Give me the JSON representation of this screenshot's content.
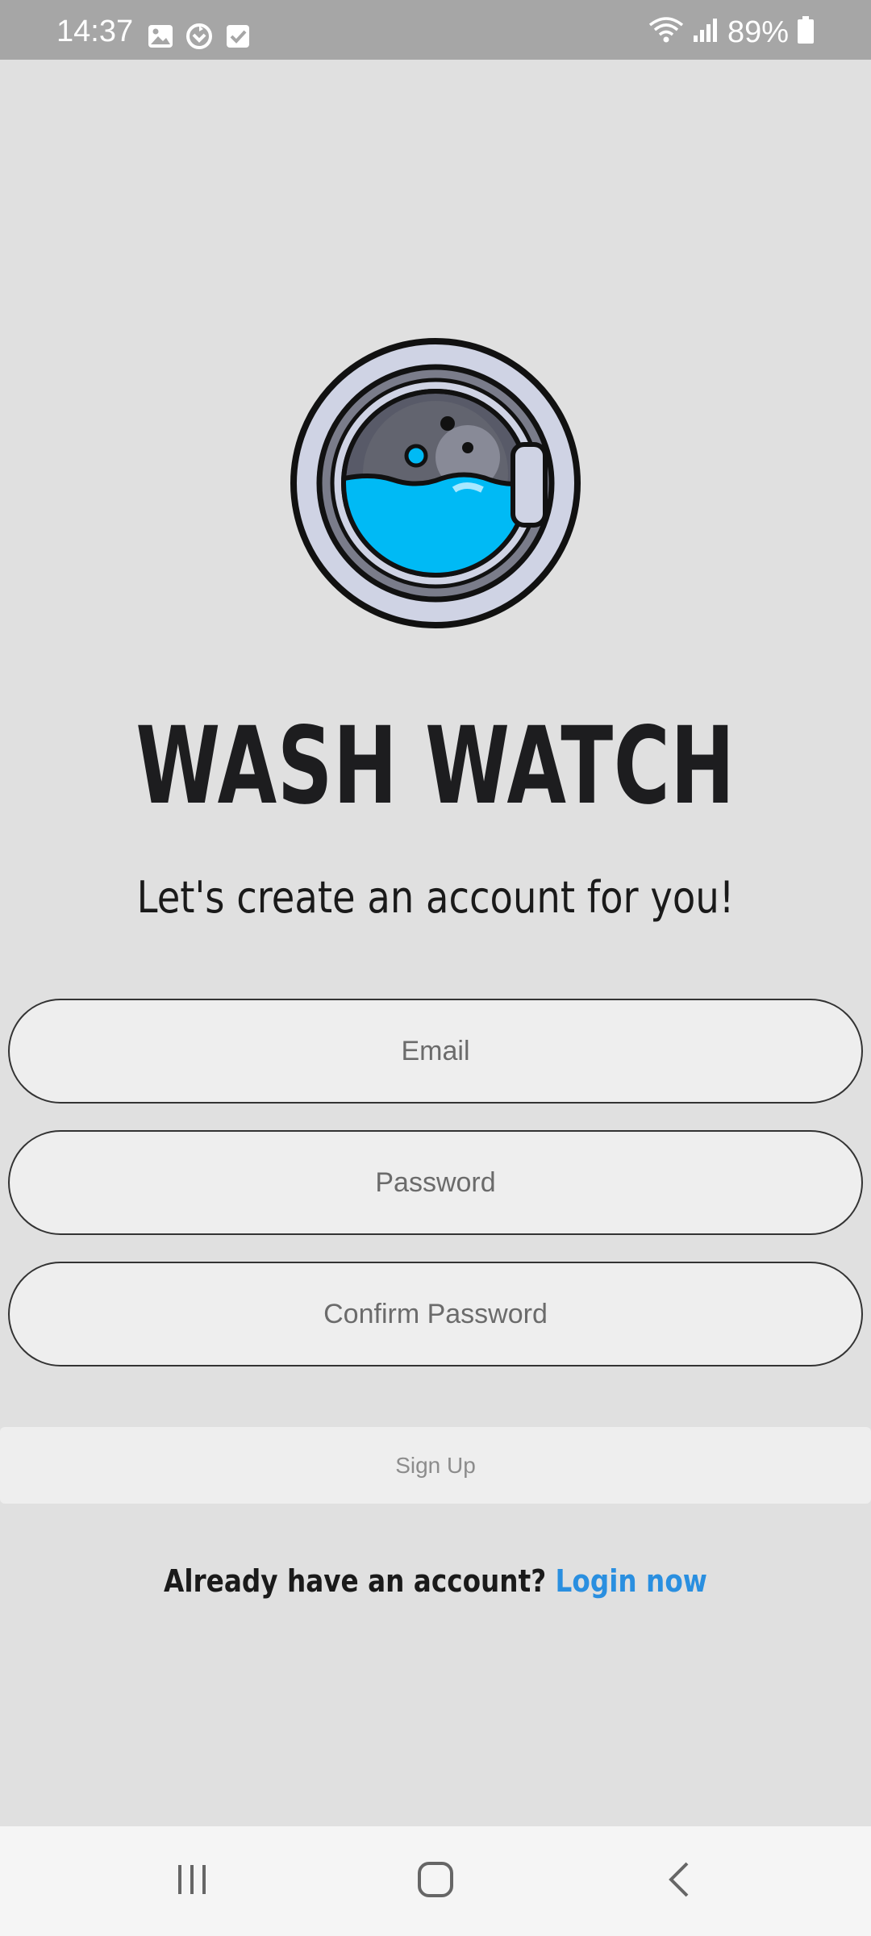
{
  "status_bar": {
    "time": "14:37",
    "left_icons": [
      "gallery-icon",
      "sync-icon",
      "checkbox-icon"
    ],
    "right_icons": [
      "wifi-icon",
      "signal-icon",
      "battery-icon"
    ],
    "battery_percent": "89%"
  },
  "app": {
    "logo_icon": "washing-machine-icon",
    "title": "WASH WATCH",
    "subtitle": "Let's create an account for you!"
  },
  "form": {
    "email_placeholder": "Email",
    "password_placeholder": "Password",
    "confirm_password_placeholder": "Confirm Password",
    "signup_label": "Sign Up"
  },
  "footer": {
    "prompt": "Already have an account?",
    "login_link": "Login now"
  },
  "nav_bar": {
    "buttons": [
      "recents-icon",
      "home-icon",
      "back-icon"
    ]
  },
  "colors": {
    "background": "#e0e0e0",
    "status_bar": "#a6a6a6",
    "link": "#2a8fe0",
    "water": "#00baf5"
  }
}
